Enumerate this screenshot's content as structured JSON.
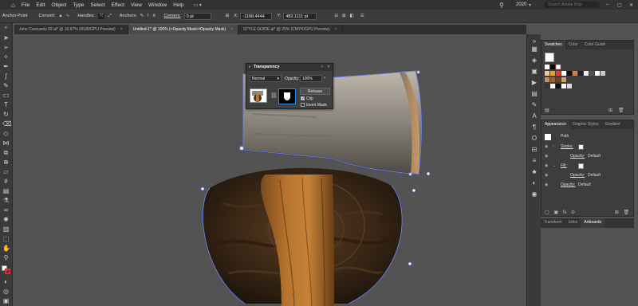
{
  "menu": [
    "File",
    "Edit",
    "Object",
    "Type",
    "Select",
    "Effect",
    "View",
    "Window",
    "Help"
  ],
  "control": {
    "selection": "Anchor Point",
    "convert": "Convert:",
    "handles": "Handles:",
    "anchors": "Anchors:",
    "corners": "Corners:",
    "corner_value": "0 pt",
    "x_value": "-1168.4444",
    "y_value": "482.1111 pt",
    "workspace": "2020",
    "search_placeholder": "Search Adobe Help"
  },
  "tabs": [
    {
      "label": "June Carousels 02.ai* @ 16.67% (RGB/GPU Preview)",
      "active": false
    },
    {
      "label": "Untitled-1* @ 100% (<Opacity Mask>/Opacity Mask)",
      "active": true
    },
    {
      "label": "STYLE GUIDE.ai* @ 25% (CMYK/GPU Preview)",
      "active": false
    }
  ],
  "transparency": {
    "title": "Transparency",
    "blend_mode": "Normal",
    "opacity_label": "Opacity:",
    "opacity_value": "100%",
    "release": "Release",
    "clip": "Clip",
    "invert": "Invert Mask"
  },
  "swatches_panel": {
    "tabs": [
      "Swatches",
      "Color",
      "Color Guide"
    ]
  },
  "appearance_panel": {
    "tabs": [
      "Appearance",
      "Graphic Styles",
      "Gradient"
    ],
    "object": "Path",
    "stroke": "Stroke:",
    "fill": "Fill:",
    "opacity": "Opacity:",
    "default": "Default"
  },
  "bottom_tabs": [
    "Transform",
    "Links",
    "Artboards"
  ],
  "colors": {
    "accent": "#2d8ceb",
    "path_outline": "#6f83ff"
  }
}
